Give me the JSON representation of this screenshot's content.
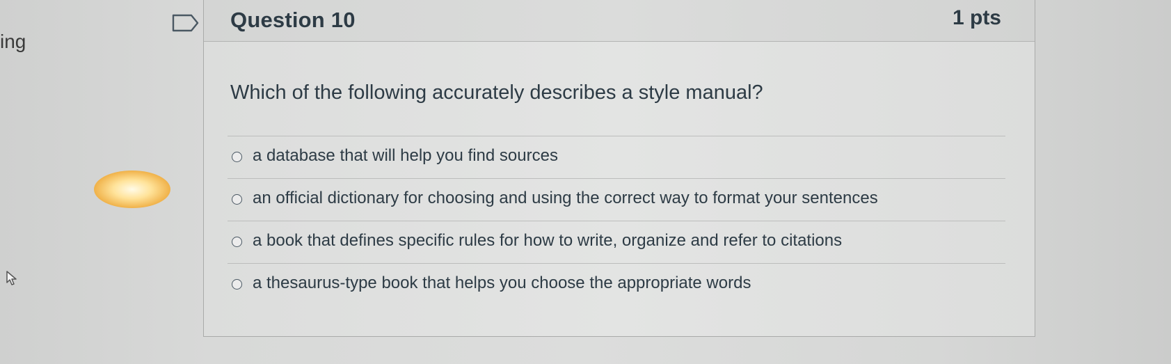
{
  "side": {
    "partial_text": "ing"
  },
  "question": {
    "title": "Question 10",
    "points": "1 pts",
    "prompt": "Which of the following accurately describes a style manual?",
    "answers": [
      {
        "label": "a database that will help you find sources"
      },
      {
        "label": "an official dictionary for choosing and using the correct way to format your sentences"
      },
      {
        "label": "a book that defines specific rules for how to write, organize and refer to citations"
      },
      {
        "label": "a thesaurus-type book that helps you choose the appropriate words"
      }
    ]
  },
  "icons": {
    "flag": "bookmark-flag-icon",
    "cursor": "mouse-pointer-icon",
    "radio": "radio-unselected"
  },
  "colors": {
    "text": "#2d3b45",
    "border": "#a9aaa9"
  }
}
